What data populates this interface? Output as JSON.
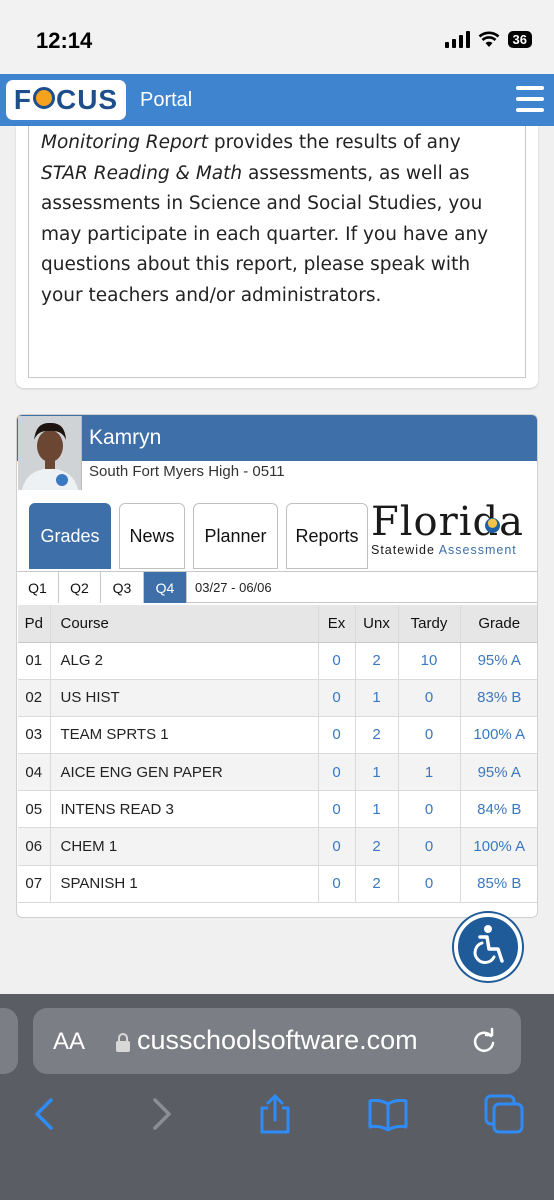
{
  "status_bar": {
    "time": "12:14",
    "battery": "36"
  },
  "header": {
    "logo_text": "FOCUS",
    "title": "Portal"
  },
  "message": {
    "line1_italic": "Monitoring Report",
    "line1_rest": " provides the results of any",
    "line2_italic": "STAR Reading & Math",
    "line2_rest": " assessments, as well as",
    "line3": "assessments in Science and Social Studies, you",
    "line4": "may participate in each quarter. If you have any",
    "line5": "questions about this report, please speak with",
    "line6": "your teachers and/or administrators."
  },
  "student": {
    "name": "Kamryn",
    "school": "South Fort Myers High - 0511"
  },
  "tabs": [
    {
      "label": "Grades",
      "active": true
    },
    {
      "label": "News",
      "active": false
    },
    {
      "label": "Planner",
      "active": false
    },
    {
      "label": "Reports",
      "active": false
    }
  ],
  "fsa_logo": {
    "word": "Florida",
    "sub_left": "Statewide ",
    "sub_right": "Assessment"
  },
  "quarters": [
    {
      "label": "Q1",
      "active": false
    },
    {
      "label": "Q2",
      "active": false
    },
    {
      "label": "Q3",
      "active": false
    },
    {
      "label": "Q4",
      "active": true
    }
  ],
  "date_range": "03/27 - 06/06",
  "grades_table": {
    "headers": {
      "pd": "Pd",
      "course": "Course",
      "ex": "Ex",
      "unx": "Unx",
      "tardy": "Tardy",
      "grade": "Grade"
    },
    "rows": [
      {
        "pd": "01",
        "course": "ALG 2",
        "ex": "0",
        "unx": "2",
        "tardy": "10",
        "grade": "95% A"
      },
      {
        "pd": "02",
        "course": "US HIST",
        "ex": "0",
        "unx": "1",
        "tardy": "0",
        "grade": "83% B"
      },
      {
        "pd": "03",
        "course": "TEAM SPRTS 1",
        "ex": "0",
        "unx": "2",
        "tardy": "0",
        "grade": "100% A"
      },
      {
        "pd": "04",
        "course": "AICE ENG GEN PAPER",
        "ex": "0",
        "unx": "1",
        "tardy": "1",
        "grade": "95% A"
      },
      {
        "pd": "05",
        "course": "INTENS READ 3",
        "ex": "0",
        "unx": "1",
        "tardy": "0",
        "grade": "84% B"
      },
      {
        "pd": "06",
        "course": "CHEM 1",
        "ex": "0",
        "unx": "2",
        "tardy": "0",
        "grade": "100% A"
      },
      {
        "pd": "07",
        "course": "SPANISH 1",
        "ex": "0",
        "unx": "2",
        "tardy": "0",
        "grade": "85% B"
      }
    ]
  },
  "browser": {
    "aa_label": "AA",
    "url": "cusschoolsoftware.com"
  },
  "colors": {
    "header_blue": "#3e84cf",
    "student_blue": "#3e6fa8",
    "link_blue": "#3a78c2"
  }
}
